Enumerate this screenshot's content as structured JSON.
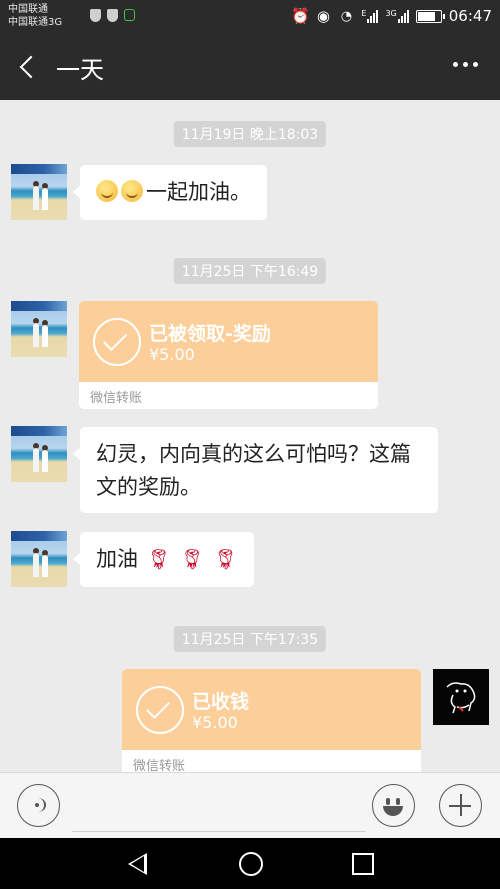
{
  "status_bar": {
    "carrier_1": "中国联通",
    "carrier_2": "中国联通3G",
    "signal_1_label": "E",
    "signal_2_label": "3G",
    "battery_level_percent": 85,
    "time": "06:47",
    "icons": [
      "shield-icon",
      "shield-icon",
      "lock-icon",
      "alarm-icon",
      "eye-icon",
      "wifi-icon",
      "signal-icon",
      "signal-icon",
      "battery-icon"
    ]
  },
  "header": {
    "title": "一天",
    "icons": [
      "back-arrow-icon",
      "more-dots-icon"
    ]
  },
  "messages": [
    {
      "type": "timestamp",
      "text": "11月19日 晚上18:03"
    },
    {
      "type": "text",
      "side": "left",
      "emoji_count": 2,
      "emoji_icon": "smile-emoji-icon",
      "text": "一起加油。"
    },
    {
      "type": "timestamp",
      "text": "11月25日 下午16:49"
    },
    {
      "type": "transfer",
      "side": "left",
      "title": "已被领取-奖励",
      "amount": "¥5.00",
      "label": "微信转账"
    },
    {
      "type": "text",
      "side": "left",
      "text": "幻灵，内向真的这么可怕吗？这篇文的奖励。"
    },
    {
      "type": "text",
      "side": "left",
      "text": "加油",
      "trailing_icons": [
        "rose-icon",
        "rose-icon",
        "rose-icon"
      ]
    },
    {
      "type": "timestamp",
      "text": "11月25日 下午17:35"
    },
    {
      "type": "transfer",
      "side": "right",
      "title": "已收钱",
      "amount": "¥5.00",
      "label": "微信转账"
    }
  ],
  "input_bar": {
    "value": "",
    "icons": [
      "voice-icon",
      "emoji-icon",
      "plus-icon"
    ]
  },
  "system_nav": {
    "icons": [
      "nav-back-icon",
      "nav-home-icon",
      "nav-recent-icon"
    ]
  },
  "colors": {
    "header_bg": "#2b2b2b",
    "chat_bg": "#ebebeb",
    "transfer_orange": "#fccf9a",
    "timestamp_bg": "#d4d4d4"
  }
}
